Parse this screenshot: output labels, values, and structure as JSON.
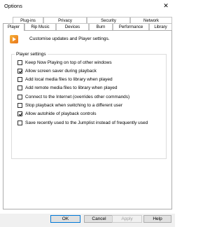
{
  "window": {
    "title": "Options",
    "close_glyph": "✕"
  },
  "tabs_row1": [
    {
      "label": "Plug-ins"
    },
    {
      "label": "Privacy"
    },
    {
      "label": "Security"
    },
    {
      "label": "Network"
    }
  ],
  "tabs_row2": [
    {
      "label": "Player",
      "active": true
    },
    {
      "label": "Rip Music"
    },
    {
      "label": "Devices"
    },
    {
      "label": "Burn"
    },
    {
      "label": "Performance"
    },
    {
      "label": "Library"
    }
  ],
  "intro": {
    "text": "Customise updates and Player settings.",
    "icon": "media-player-icon"
  },
  "group": {
    "label": "Player settings",
    "options": [
      {
        "label": "Keep Now Playing on top of other windows",
        "checked": false
      },
      {
        "label": "Allow screen saver during playback",
        "checked": true
      },
      {
        "label": "Add local media files to library when played",
        "checked": false
      },
      {
        "label": "Add remote media files to library when played",
        "checked": false
      },
      {
        "label": "Connect to the Internet (overrides other commands)",
        "checked": false
      },
      {
        "label": "Stop playback when switching to a different user",
        "checked": false
      },
      {
        "label": "Allow autohide of playback controls",
        "checked": true
      },
      {
        "label": "Save recently used to the Jumplist instead of frequently used",
        "checked": false
      }
    ]
  },
  "buttons": {
    "ok": "OK",
    "cancel": "Cancel",
    "apply": "Apply",
    "help": "Help"
  },
  "colors": {
    "accent": "#0078d7",
    "border": "#adadad",
    "footer_bg": "#f0f0f0"
  }
}
